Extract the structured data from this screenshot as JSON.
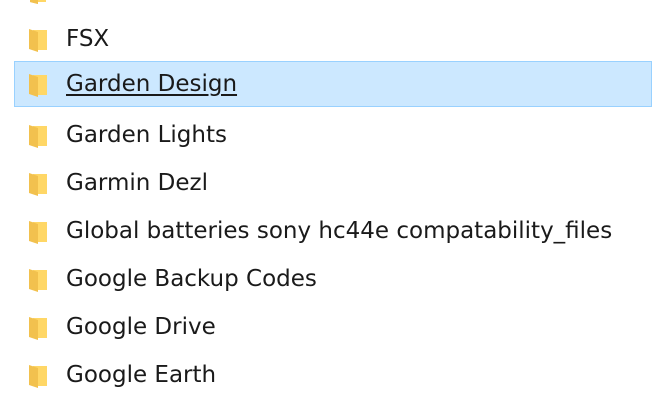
{
  "file_list": {
    "items": [
      {
        "name": "",
        "icon": "folder-icon",
        "selected": false,
        "partially_visible": true
      },
      {
        "name": "FSX",
        "icon": "folder-icon",
        "selected": false
      },
      {
        "name": "Garden Design",
        "icon": "folder-icon",
        "selected": true
      },
      {
        "name": "Garden Lights",
        "icon": "folder-icon",
        "selected": false
      },
      {
        "name": "Garmin Dezl",
        "icon": "folder-icon",
        "selected": false
      },
      {
        "name": "Global batteries sony hc44e compatability_files",
        "icon": "folder-icon",
        "selected": false
      },
      {
        "name": "Google Backup Codes",
        "icon": "folder-icon",
        "selected": false
      },
      {
        "name": "Google Drive",
        "icon": "folder-icon",
        "selected": false
      },
      {
        "name": "Google Earth",
        "icon": "folder-icon",
        "selected": false
      }
    ]
  },
  "colors": {
    "selection_background": "#cce8ff",
    "selection_border": "#99d1ff",
    "folder_front": "#ffd766",
    "folder_back": "#e8b447",
    "text": "#1a1a1a"
  }
}
